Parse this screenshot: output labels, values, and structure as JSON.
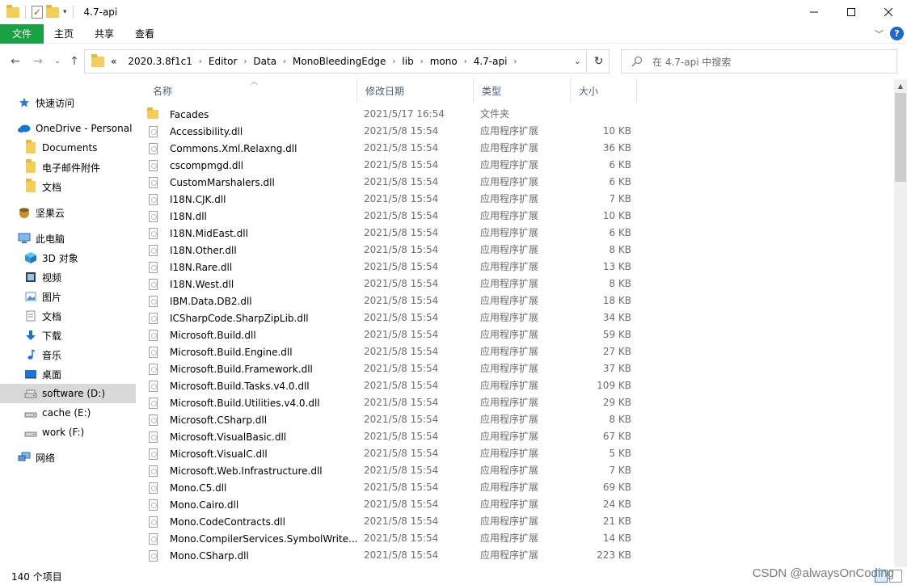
{
  "window": {
    "title": "4.7-api",
    "minimize": "minimize",
    "maximize": "maximize",
    "close": "close"
  },
  "ribbon": {
    "tabs": [
      "文件",
      "主页",
      "共享",
      "查看"
    ],
    "help": "?"
  },
  "address": {
    "overflow": "«",
    "breadcrumb": [
      "2020.3.8f1c1",
      "Editor",
      "Data",
      "MonoBleedingEdge",
      "lib",
      "mono",
      "4.7-api"
    ]
  },
  "search": {
    "placeholder": "在 4.7-api 中搜索"
  },
  "sidebar": {
    "items": [
      {
        "label": "快速访问",
        "icon": "star-pin-icon",
        "level": 0
      },
      {
        "label": "OneDrive - Personal",
        "icon": "onedrive-icon",
        "level": 0
      },
      {
        "label": "Documents",
        "icon": "folder-icon",
        "level": 1
      },
      {
        "label": "电子邮件附件",
        "icon": "folder-icon",
        "level": 1
      },
      {
        "label": "文档",
        "icon": "folder-icon",
        "level": 1
      },
      {
        "label": "坚果云",
        "icon": "nutstore-icon",
        "level": 0
      },
      {
        "label": "此电脑",
        "icon": "pc-icon",
        "level": 0
      },
      {
        "label": "3D 对象",
        "icon": "3d-objects-icon",
        "level": 1
      },
      {
        "label": "视频",
        "icon": "video-icon",
        "level": 1
      },
      {
        "label": "图片",
        "icon": "pictures-icon",
        "level": 1
      },
      {
        "label": "文档",
        "icon": "documents-icon",
        "level": 1
      },
      {
        "label": "下载",
        "icon": "download-icon",
        "level": 1
      },
      {
        "label": "音乐",
        "icon": "music-icon",
        "level": 1
      },
      {
        "label": "桌面",
        "icon": "desktop-icon",
        "level": 1
      },
      {
        "label": "software (D:)",
        "icon": "drive-icon",
        "level": 1,
        "selected": true
      },
      {
        "label": "cache (E:)",
        "icon": "drive-icon",
        "level": 1
      },
      {
        "label": "work (F:)",
        "icon": "drive-icon",
        "level": 1
      },
      {
        "label": "网络",
        "icon": "network-icon",
        "level": 0
      }
    ]
  },
  "columns": {
    "name": "名称",
    "date": "修改日期",
    "type": "类型",
    "size": "大小"
  },
  "files": [
    {
      "name": "Facades",
      "date": "2021/5/17 16:54",
      "type": "文件夹",
      "size": "",
      "kind": "folder"
    },
    {
      "name": "Accessibility.dll",
      "date": "2021/5/8 15:54",
      "type": "应用程序扩展",
      "size": "10 KB",
      "kind": "dll"
    },
    {
      "name": "Commons.Xml.Relaxng.dll",
      "date": "2021/5/8 15:54",
      "type": "应用程序扩展",
      "size": "36 KB",
      "kind": "dll"
    },
    {
      "name": "cscompmgd.dll",
      "date": "2021/5/8 15:54",
      "type": "应用程序扩展",
      "size": "6 KB",
      "kind": "dll"
    },
    {
      "name": "CustomMarshalers.dll",
      "date": "2021/5/8 15:54",
      "type": "应用程序扩展",
      "size": "6 KB",
      "kind": "dll"
    },
    {
      "name": "I18N.CJK.dll",
      "date": "2021/5/8 15:54",
      "type": "应用程序扩展",
      "size": "7 KB",
      "kind": "dll"
    },
    {
      "name": "I18N.dll",
      "date": "2021/5/8 15:54",
      "type": "应用程序扩展",
      "size": "10 KB",
      "kind": "dll"
    },
    {
      "name": "I18N.MidEast.dll",
      "date": "2021/5/8 15:54",
      "type": "应用程序扩展",
      "size": "6 KB",
      "kind": "dll"
    },
    {
      "name": "I18N.Other.dll",
      "date": "2021/5/8 15:54",
      "type": "应用程序扩展",
      "size": "8 KB",
      "kind": "dll"
    },
    {
      "name": "I18N.Rare.dll",
      "date": "2021/5/8 15:54",
      "type": "应用程序扩展",
      "size": "13 KB",
      "kind": "dll"
    },
    {
      "name": "I18N.West.dll",
      "date": "2021/5/8 15:54",
      "type": "应用程序扩展",
      "size": "8 KB",
      "kind": "dll"
    },
    {
      "name": "IBM.Data.DB2.dll",
      "date": "2021/5/8 15:54",
      "type": "应用程序扩展",
      "size": "18 KB",
      "kind": "dll"
    },
    {
      "name": "ICSharpCode.SharpZipLib.dll",
      "date": "2021/5/8 15:54",
      "type": "应用程序扩展",
      "size": "34 KB",
      "kind": "dll"
    },
    {
      "name": "Microsoft.Build.dll",
      "date": "2021/5/8 15:54",
      "type": "应用程序扩展",
      "size": "59 KB",
      "kind": "dll"
    },
    {
      "name": "Microsoft.Build.Engine.dll",
      "date": "2021/5/8 15:54",
      "type": "应用程序扩展",
      "size": "27 KB",
      "kind": "dll"
    },
    {
      "name": "Microsoft.Build.Framework.dll",
      "date": "2021/5/8 15:54",
      "type": "应用程序扩展",
      "size": "37 KB",
      "kind": "dll"
    },
    {
      "name": "Microsoft.Build.Tasks.v4.0.dll",
      "date": "2021/5/8 15:54",
      "type": "应用程序扩展",
      "size": "109 KB",
      "kind": "dll"
    },
    {
      "name": "Microsoft.Build.Utilities.v4.0.dll",
      "date": "2021/5/8 15:54",
      "type": "应用程序扩展",
      "size": "29 KB",
      "kind": "dll"
    },
    {
      "name": "Microsoft.CSharp.dll",
      "date": "2021/5/8 15:54",
      "type": "应用程序扩展",
      "size": "8 KB",
      "kind": "dll"
    },
    {
      "name": "Microsoft.VisualBasic.dll",
      "date": "2021/5/8 15:54",
      "type": "应用程序扩展",
      "size": "67 KB",
      "kind": "dll"
    },
    {
      "name": "Microsoft.VisualC.dll",
      "date": "2021/5/8 15:54",
      "type": "应用程序扩展",
      "size": "5 KB",
      "kind": "dll"
    },
    {
      "name": "Microsoft.Web.Infrastructure.dll",
      "date": "2021/5/8 15:54",
      "type": "应用程序扩展",
      "size": "7 KB",
      "kind": "dll"
    },
    {
      "name": "Mono.C5.dll",
      "date": "2021/5/8 15:54",
      "type": "应用程序扩展",
      "size": "69 KB",
      "kind": "dll"
    },
    {
      "name": "Mono.Cairo.dll",
      "date": "2021/5/8 15:54",
      "type": "应用程序扩展",
      "size": "24 KB",
      "kind": "dll"
    },
    {
      "name": "Mono.CodeContracts.dll",
      "date": "2021/5/8 15:54",
      "type": "应用程序扩展",
      "size": "21 KB",
      "kind": "dll"
    },
    {
      "name": "Mono.CompilerServices.SymbolWrite...",
      "date": "2021/5/8 15:54",
      "type": "应用程序扩展",
      "size": "14 KB",
      "kind": "dll"
    },
    {
      "name": "Mono.CSharp.dll",
      "date": "2021/5/8 15:54",
      "type": "应用程序扩展",
      "size": "223 KB",
      "kind": "dll"
    }
  ],
  "status": {
    "count": "140 个项目"
  },
  "watermark": "CSDN @alwaysOnCoding",
  "colors": {
    "file_tab": "#19a244",
    "selection": "#d9d9d9",
    "header_text": "#4c607a",
    "folder": "#f4cd5a"
  }
}
